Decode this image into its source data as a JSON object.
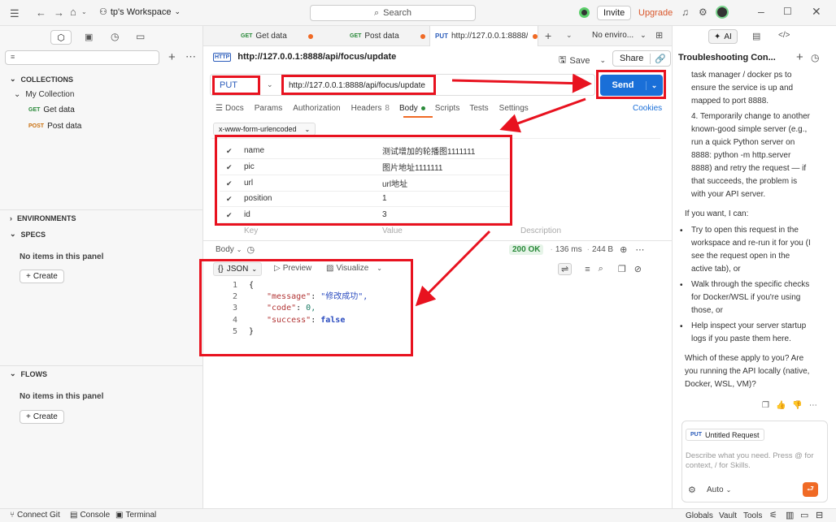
{
  "topbar": {
    "workspace": "tp's Workspace",
    "search_placeholder": "Search",
    "invite": "Invite",
    "upgrade": "Upgrade"
  },
  "tabs": [
    {
      "method": "GET",
      "name": "Get data"
    },
    {
      "method": "GET",
      "name": "Post data"
    },
    {
      "method": "PUT",
      "name": "http://127.0.0.1:8888/ap"
    }
  ],
  "env_select": "No enviro...",
  "sidebar": {
    "collections_label": "COLLECTIONS",
    "collection_name": "My Collection",
    "items": [
      {
        "method": "GET",
        "name": "Get data"
      },
      {
        "method": "POST",
        "name": "Post data"
      }
    ],
    "environments_label": "ENVIRONMENTS",
    "specs_label": "SPECS",
    "specs_empty": "No items in this panel",
    "specs_create": "Create",
    "flows_label": "FLOWS",
    "flows_empty": "No items in this panel",
    "flows_create": "Create"
  },
  "request": {
    "title": "http://127.0.0.1:8888/api/focus/update",
    "save": "Save",
    "share": "Share",
    "method": "PUT",
    "url": "http://127.0.0.1:8888/api/focus/update",
    "send": "Send",
    "subtabs": [
      "Docs",
      "Params",
      "Authorization",
      "Headers",
      "Body",
      "Scripts",
      "Tests",
      "Settings"
    ],
    "headers_count": "8",
    "cookies": "Cookies",
    "body_type": "x-www-form-urlencoded",
    "params": [
      {
        "key": "name",
        "value": "测试增加的轮播图1111111"
      },
      {
        "key": "pic",
        "value": "图片地址1111111"
      },
      {
        "key": "url",
        "value": "url地址"
      },
      {
        "key": "position",
        "value": "1"
      },
      {
        "key": "id",
        "value": "3"
      }
    ],
    "placeholder_key": "Key",
    "placeholder_value": "Value",
    "placeholder_desc": "Description"
  },
  "response": {
    "body_label": "Body",
    "status": "200 OK",
    "time": "136 ms",
    "size": "244 B",
    "format": "JSON",
    "preview": "Preview",
    "visualize": "Visualize",
    "lines": [
      {
        "n": "1",
        "text": "{"
      },
      {
        "n": "2",
        "key": "\"message\"",
        "val": "\"修改成功\","
      },
      {
        "n": "3",
        "key": "\"code\"",
        "val": "0,"
      },
      {
        "n": "4",
        "key": "\"success\"",
        "val": "false"
      },
      {
        "n": "5",
        "text": "}"
      }
    ]
  },
  "ai_panel": {
    "tab": "AI",
    "title": "Troubleshooting Con...",
    "para1": [
      "task manager / docker ps to",
      "ensure the service is up and",
      "mapped to port 8888."
    ],
    "para2": [
      "4. Temporarily change to another",
      "known-good simple server (e.g.,",
      "run a quick Python server on",
      "8888: python -m http.server",
      "8888) and retry the request — if",
      "that succeeds, the problem is",
      "with your API server."
    ],
    "intro": "If you want, I can:",
    "bullet1": [
      "Try to open this request in the",
      "workspace and re-run it for you (I",
      "see the request open in the",
      "active tab), or"
    ],
    "bullet2": [
      "Walk through the specific checks",
      "for Docker/WSL if you're using",
      "those, or"
    ],
    "bullet3": [
      "Help inspect your server startup",
      "logs if you paste them here."
    ],
    "question": [
      "Which of these apply to you? Are",
      "you running the API locally (native,",
      "Docker, WSL, VM)?"
    ],
    "context_method": "PUT",
    "context_name": "Untitled Request",
    "input_placeholder": "Describe what you need. Press @ for context, / for Skills.",
    "mode": "Auto"
  },
  "statusbar": {
    "git": "Connect Git",
    "console": "Console",
    "terminal": "Terminal",
    "globals": "Globals",
    "vault": "Vault",
    "tools": "Tools"
  },
  "colors": {
    "accent": "#1a6fd8",
    "upgrade": "#d9572b",
    "annotation": "#e8121f",
    "status_ok": "#2a8a3a"
  }
}
